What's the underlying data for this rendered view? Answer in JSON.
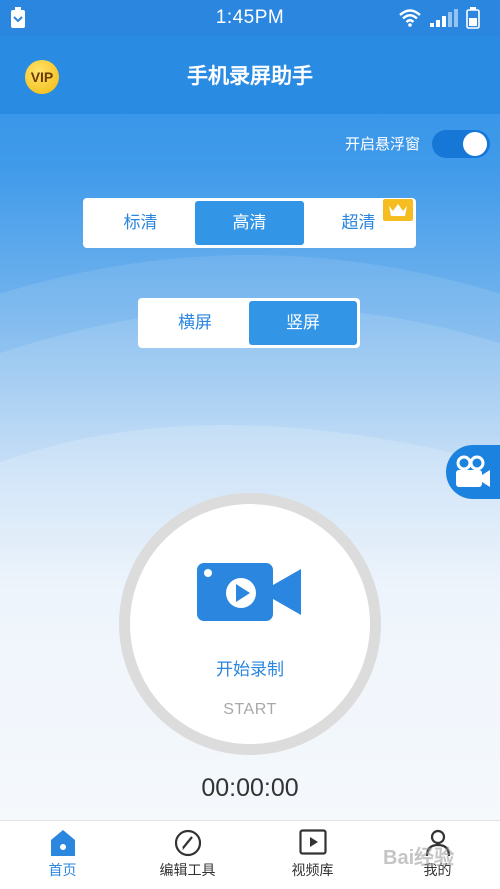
{
  "status_bar": {
    "time": "1:45PM"
  },
  "header": {
    "vip_badge": "VIP",
    "title": "手机录屏助手"
  },
  "floating_window": {
    "label": "开启悬浮窗",
    "enabled": true
  },
  "quality": {
    "options": [
      "标清",
      "高清",
      "超清"
    ],
    "selected": "高清"
  },
  "orientation": {
    "options": [
      "横屏",
      "竖屏"
    ],
    "selected": "竖屏"
  },
  "record": {
    "label": "开始录制",
    "sub_label": "START",
    "timer": "00:00:00"
  },
  "tabs": [
    {
      "label": "首页",
      "icon": "home-icon",
      "active": true
    },
    {
      "label": "编辑工具",
      "icon": "edit-icon",
      "active": false
    },
    {
      "label": "视频库",
      "icon": "video-library-icon",
      "active": false
    },
    {
      "label": "我的",
      "icon": "user-icon",
      "active": false
    }
  ],
  "watermark": "Bai经验",
  "colors": {
    "primary": "#2a86de",
    "accent_gold": "#f6bd21",
    "toggle_on": "#1677d6"
  }
}
